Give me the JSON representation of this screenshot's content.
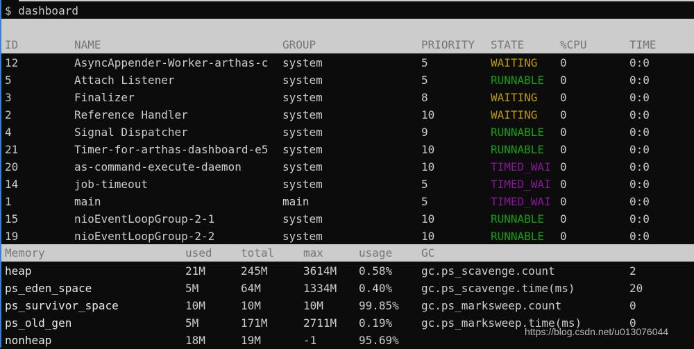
{
  "terminal": {
    "prompt": "$ dashboard"
  },
  "threads": {
    "columns": [
      "ID",
      "NAME",
      "GROUP",
      "PRIORITY",
      "STATE",
      "%CPU",
      "TIME"
    ],
    "rows": [
      {
        "id": "12",
        "name": "AsyncAppender-Worker-arthas-c",
        "group": "system",
        "priority": "5",
        "state": "WAITING",
        "state_class": "WAITING",
        "cpu": "0",
        "time": "0:0"
      },
      {
        "id": "5",
        "name": "Attach Listener",
        "group": "system",
        "priority": "5",
        "state": "RUNNABLE",
        "state_class": "RUNNABLE",
        "cpu": "0",
        "time": "0:0"
      },
      {
        "id": "3",
        "name": "Finalizer",
        "group": "system",
        "priority": "8",
        "state": "WAITING",
        "state_class": "WAITING",
        "cpu": "0",
        "time": "0:0"
      },
      {
        "id": "2",
        "name": "Reference Handler",
        "group": "system",
        "priority": "10",
        "state": "WAITING",
        "state_class": "WAITING",
        "cpu": "0",
        "time": "0:0"
      },
      {
        "id": "4",
        "name": "Signal Dispatcher",
        "group": "system",
        "priority": "9",
        "state": "RUNNABLE",
        "state_class": "RUNNABLE",
        "cpu": "0",
        "time": "0:0"
      },
      {
        "id": "21",
        "name": "Timer-for-arthas-dashboard-e5",
        "group": "system",
        "priority": "10",
        "state": "RUNNABLE",
        "state_class": "RUNNABLE",
        "cpu": "0",
        "time": "0:0"
      },
      {
        "id": "20",
        "name": "as-command-execute-daemon",
        "group": "system",
        "priority": "10",
        "state": "TIMED_WAI",
        "state_class": "TIMED_WAITING",
        "cpu": "0",
        "time": "0:0"
      },
      {
        "id": "14",
        "name": "job-timeout",
        "group": "system",
        "priority": "5",
        "state": "TIMED_WAI",
        "state_class": "TIMED_WAITING",
        "cpu": "0",
        "time": "0:0"
      },
      {
        "id": "1",
        "name": "main",
        "group": "main",
        "priority": "5",
        "state": "TIMED_WAI",
        "state_class": "TIMED_WAITING",
        "cpu": "0",
        "time": "0:0"
      },
      {
        "id": "15",
        "name": "nioEventLoopGroup-2-1",
        "group": "system",
        "priority": "10",
        "state": "RUNNABLE",
        "state_class": "RUNNABLE",
        "cpu": "0",
        "time": "0:0"
      },
      {
        "id": "19",
        "name": "nioEventLoopGroup-2-2",
        "group": "system",
        "priority": "10",
        "state": "RUNNABLE",
        "state_class": "RUNNABLE",
        "cpu": "0",
        "time": "0:0"
      }
    ]
  },
  "memory": {
    "columns": [
      "Memory",
      "used",
      "total",
      "max",
      "usage"
    ],
    "rows": [
      {
        "name": "heap",
        "used": "21M",
        "total": "245M",
        "max": "3614M",
        "usage": "0.58%"
      },
      {
        "name": "ps_eden_space",
        "used": "5M",
        "total": "64M",
        "max": "1334M",
        "usage": "0.40%"
      },
      {
        "name": "ps_survivor_space",
        "used": "10M",
        "total": "10M",
        "max": "10M",
        "usage": "99.85%"
      },
      {
        "name": "ps_old_gen",
        "used": "5M",
        "total": "171M",
        "max": "2711M",
        "usage": "0.19%"
      },
      {
        "name": "nonheap",
        "used": "18M",
        "total": "19M",
        "max": "-1",
        "usage": "95.69%"
      }
    ]
  },
  "gc": {
    "header": "GC",
    "rows": [
      {
        "name": "gc.ps_scavenge.count",
        "value": "2"
      },
      {
        "name": "gc.ps_scavenge.time(ms)",
        "value": "20"
      },
      {
        "name": "gc.ps_marksweep.count",
        "value": "0"
      },
      {
        "name": "gc.ps_marksweep.time(ms)",
        "value": "0"
      }
    ]
  },
  "watermark": "https://blog.csdn.net/u013076044"
}
